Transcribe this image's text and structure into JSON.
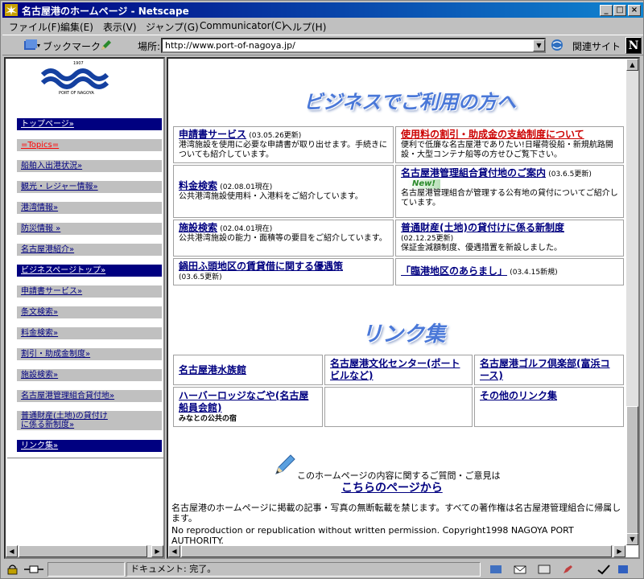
{
  "window": {
    "title": "名古屋港のホームページ - Netscape",
    "btn_min": "_",
    "btn_max": "□",
    "btn_close": "×"
  },
  "menu": [
    "ファイル(F)",
    "編集(E)",
    "表示(V)",
    "ジャンプ(G)",
    "Communicator(C)",
    "ヘルプ(H)"
  ],
  "locationbar": {
    "bookmarks": "ブックマーク",
    "label": "場所:",
    "url": "http://www.port-of-nagoya.jp/",
    "related": "関連サイト",
    "brand": "N"
  },
  "logo": {
    "year": "1907",
    "caption": "PORT OF NAGOYA"
  },
  "nav": [
    "トップページ»",
    "=Topics=",
    "船舶入出港状況»",
    "観光・レジャー情報»",
    "港湾情報»",
    "防災情報 »",
    "名古屋港紹介»",
    "ビジネスページトップ»",
    "申請書サービス»",
    "条文検索»",
    "料金検索»",
    "割引・助成金制度»",
    "施設検索»",
    "名古屋港管理組合貸付地»",
    "普通財産(土地)の貸付け\nに係る新制度»",
    "リンク集»"
  ],
  "business": {
    "heading": "ビジネスでご利用の方へ",
    "cells": [
      {
        "title": "申請書サービス",
        "date": "(03.05.26更新)",
        "desc": "港湾施設を使用に必要な申請書が取り出せます。手続きについても紹介しています。"
      },
      {
        "title": "使用料の割引・助成金の支給制度について",
        "date": "",
        "desc": "便利で低廉な名古屋港でありたい!日曜荷役船・新規航路開設・大型コンテナ船等の方せひご覧下さい。"
      },
      {
        "title": "料金検索",
        "date": "(02.08.01現在)",
        "desc": "公共港湾施設使用料・入港料をご紹介しています。"
      },
      {
        "title": "名古屋港管理組合貸付地のご案内",
        "date": "(03.6.5更新)",
        "badge": "New!",
        "desc": "名古屋港管理組合が管理する公有地の貸付についてご紹介しています。"
      },
      {
        "title": "施設検索",
        "date": "(02.04.01現在)",
        "desc": "公共港湾施設の能力・面積等の要目をご紹介しています。"
      },
      {
        "title": "普通財産(土地)の貸付けに係る新制度",
        "date": "(02.12.25更新)",
        "desc": "保証金減額制度、優遇措置を新設しました。"
      },
      {
        "title": "鍋田ふ頭地区の賃貸借に関する優遇策",
        "date": "(03.6.5更新)",
        "desc": ""
      },
      {
        "title": "「臨港地区のあらまし」",
        "date": "(03.4.15新規)",
        "desc": ""
      }
    ]
  },
  "links": {
    "heading": "リンク集",
    "cells": [
      {
        "title": "名古屋港水族館",
        "sub": ""
      },
      {
        "title": "名古屋港文化センター(ポートビルなど)",
        "sub": ""
      },
      {
        "title": "名古屋港ゴルフ倶楽部(富浜コース)",
        "sub": ""
      },
      {
        "title": "ハーバーロッジなごや(名古屋船員会館)",
        "sub": "みなとの公共の宿"
      },
      {
        "title": "",
        "sub": ""
      },
      {
        "title": "その他のリンク集",
        "sub": ""
      }
    ]
  },
  "contact": {
    "text": "このホームページの内容に関するご質問・ご意見は",
    "link": "こちらのページから"
  },
  "copyright": {
    "jp": "名古屋港のホームページに掲載の記事・写真の無断転載を禁じます。すべての著作権は名古屋港管理組合に帰属します。",
    "en": "No reproduction or republication without written permission. Copyright1998 NAGOYA PORT AUTHORITY."
  },
  "status": {
    "text": "ドキュメント: 完了。"
  },
  "colors": {
    "titlebar": "#000080",
    "link": "#000080",
    "nav_dark": "#000080",
    "red_link": "#cc0000"
  }
}
